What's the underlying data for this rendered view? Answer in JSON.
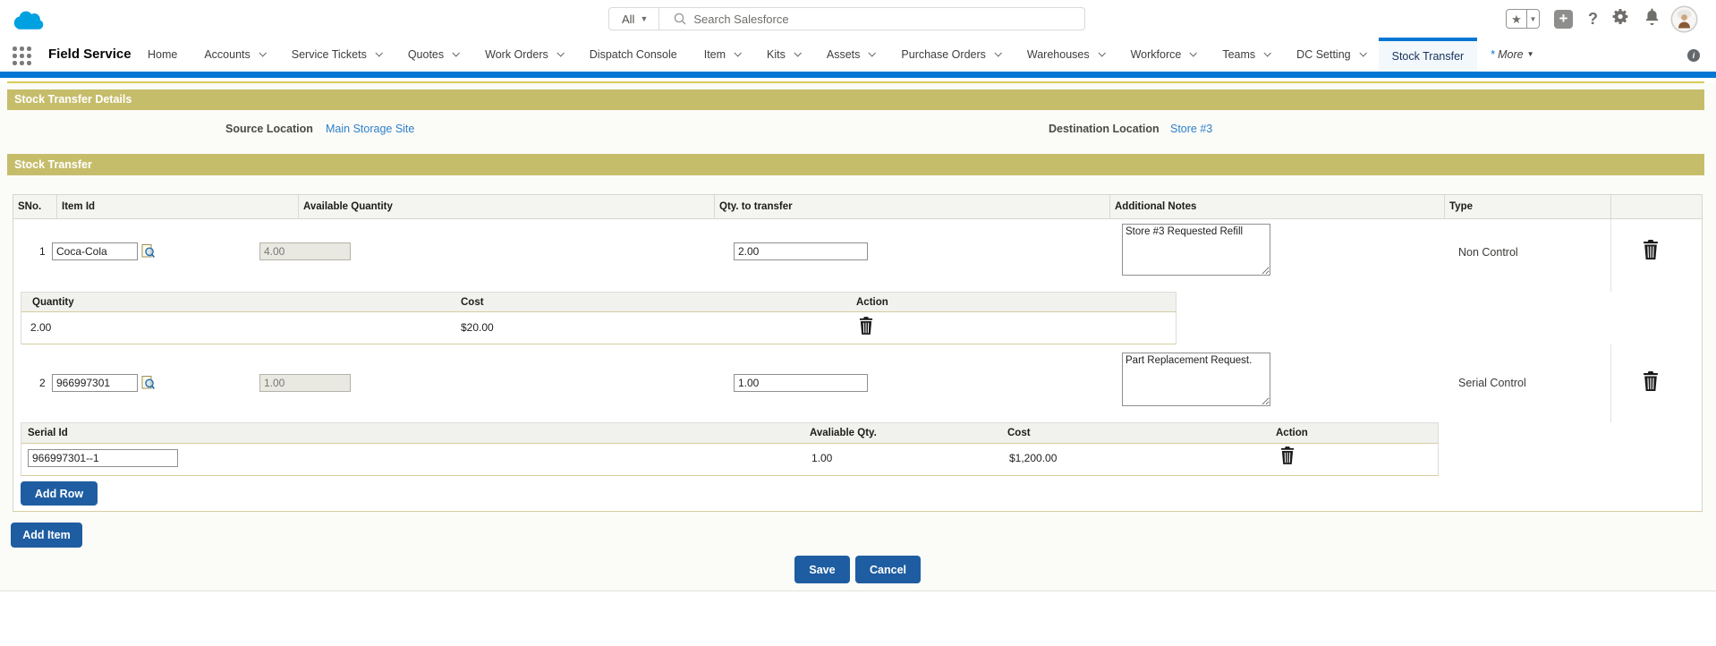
{
  "header": {
    "search_scope": "All",
    "search_placeholder": "Search Salesforce"
  },
  "nav": {
    "app_name": "Field Service",
    "tabs": [
      {
        "label": "Home",
        "dropdown": false
      },
      {
        "label": "Accounts",
        "dropdown": true
      },
      {
        "label": "Service Tickets",
        "dropdown": true
      },
      {
        "label": "Quotes",
        "dropdown": true
      },
      {
        "label": "Work Orders",
        "dropdown": true
      },
      {
        "label": "Dispatch Console",
        "dropdown": false
      },
      {
        "label": "Item",
        "dropdown": true
      },
      {
        "label": "Kits",
        "dropdown": true
      },
      {
        "label": "Assets",
        "dropdown": true
      },
      {
        "label": "Purchase Orders",
        "dropdown": true
      },
      {
        "label": "Warehouses",
        "dropdown": true
      },
      {
        "label": "Workforce",
        "dropdown": true
      },
      {
        "label": "Teams",
        "dropdown": true
      },
      {
        "label": "DC Setting",
        "dropdown": true
      },
      {
        "label": "Stock Transfer",
        "dropdown": false,
        "active": true
      },
      {
        "label": "More",
        "dropdown": true,
        "prefix": "*",
        "italic": true
      }
    ]
  },
  "details": {
    "section_title": "Stock Transfer Details",
    "source_label": "Source Location",
    "source_value": "Main Storage Site",
    "destination_label": "Destination Location",
    "destination_value": "Store #3"
  },
  "transfer": {
    "section_title": "Stock Transfer",
    "columns": [
      "SNo.",
      "Item Id",
      "Available Quantity",
      "Qty. to transfer",
      "Additional Notes",
      "Type"
    ],
    "rows": [
      {
        "sno": "1",
        "item_id": "Coca-Cola",
        "available_quantity": "4.00",
        "qty_to_transfer": "2.00",
        "notes": "Store #3 Requested Refill",
        "type": "Non Control"
      },
      {
        "sno": "2",
        "item_id": "966997301",
        "available_quantity": "1.00",
        "qty_to_transfer": "1.00",
        "notes": "Part Replacement Request.",
        "type": "Serial Control"
      }
    ],
    "quantity_table": {
      "columns": [
        "Quantity",
        "Cost",
        "Action"
      ],
      "rows": [
        {
          "quantity": "2.00",
          "cost": "$20.00"
        }
      ]
    },
    "serial_table": {
      "columns": [
        "Serial Id",
        "Avaliable Qty.",
        "Cost",
        "Action"
      ],
      "rows": [
        {
          "serial_id": "966997301--1",
          "available_qty": "1.00",
          "cost": "$1,200.00"
        }
      ]
    },
    "add_row_label": "Add Row",
    "add_item_label": "Add Item"
  },
  "actions": {
    "save_label": "Save",
    "cancel_label": "Cancel"
  },
  "colors": {
    "brand_blue": "#0176d3",
    "section_olive": "#c6bd6b",
    "button_blue": "#1e5da1",
    "link_blue": "#2f80c8",
    "accent_yellow": "#d9cd5a"
  }
}
